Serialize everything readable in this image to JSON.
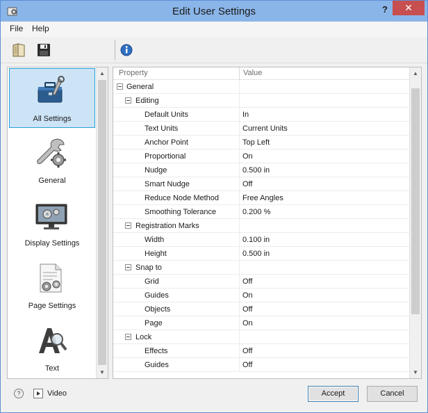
{
  "window": {
    "title": "Edit User Settings",
    "help_glyph": "?",
    "close_glyph": "✕"
  },
  "menu": {
    "items": [
      "File",
      "Help"
    ]
  },
  "toolbar": {
    "icons": [
      "folder-icon",
      "save-icon",
      "info-icon"
    ]
  },
  "categories": [
    {
      "label": "All Settings",
      "icon": "toolbox-icon",
      "selected": true
    },
    {
      "label": "General",
      "icon": "wrench-gear-icon"
    },
    {
      "label": "Display Settings",
      "icon": "monitor-gear-icon"
    },
    {
      "label": "Page Settings",
      "icon": "page-gear-icon"
    },
    {
      "label": "Text",
      "icon": "text-magnifier-icon"
    }
  ],
  "grid": {
    "columns": {
      "property": "Property",
      "value": "Value"
    },
    "rows": [
      {
        "level": 0,
        "expander": true,
        "property": "General",
        "value": ""
      },
      {
        "level": 1,
        "expander": true,
        "property": "Editing",
        "value": ""
      },
      {
        "level": 2,
        "expander": false,
        "property": "Default Units",
        "value": "In"
      },
      {
        "level": 2,
        "expander": false,
        "property": "Text Units",
        "value": "Current Units"
      },
      {
        "level": 2,
        "expander": false,
        "property": "Anchor Point",
        "value": "Top Left"
      },
      {
        "level": 2,
        "expander": false,
        "property": "Proportional",
        "value": "On"
      },
      {
        "level": 2,
        "expander": false,
        "property": "Nudge",
        "value": "0.500 in"
      },
      {
        "level": 2,
        "expander": false,
        "property": "Smart Nudge",
        "value": "Off"
      },
      {
        "level": 2,
        "expander": false,
        "property": "Reduce Node Method",
        "value": "Free Angles"
      },
      {
        "level": 2,
        "expander": false,
        "property": "Smoothing Tolerance",
        "value": "0.200 %"
      },
      {
        "level": 1,
        "expander": true,
        "property": "Registration Marks",
        "value": ""
      },
      {
        "level": 2,
        "expander": false,
        "property": "Width",
        "value": "0.100 in"
      },
      {
        "level": 2,
        "expander": false,
        "property": "Height",
        "value": "0.500 in"
      },
      {
        "level": 1,
        "expander": true,
        "property": "Snap to",
        "value": ""
      },
      {
        "level": 2,
        "expander": false,
        "property": "Grid",
        "value": "Off"
      },
      {
        "level": 2,
        "expander": false,
        "property": "Guides",
        "value": "On"
      },
      {
        "level": 2,
        "expander": false,
        "property": "Objects",
        "value": "Off"
      },
      {
        "level": 2,
        "expander": false,
        "property": "Page",
        "value": "On"
      },
      {
        "level": 1,
        "expander": true,
        "property": "Lock",
        "value": ""
      },
      {
        "level": 2,
        "expander": false,
        "property": "Effects",
        "value": "Off"
      },
      {
        "level": 2,
        "expander": false,
        "property": "Guides",
        "value": "Off"
      }
    ]
  },
  "footer": {
    "help_glyph": "?",
    "video_label": "Video",
    "accept_label": "Accept",
    "cancel_label": "Cancel"
  },
  "colors": {
    "titlebar": "#8ab5e8",
    "close_button": "#c74f4f",
    "selection": "#cde4f7",
    "selection_border": "#26a0da"
  }
}
